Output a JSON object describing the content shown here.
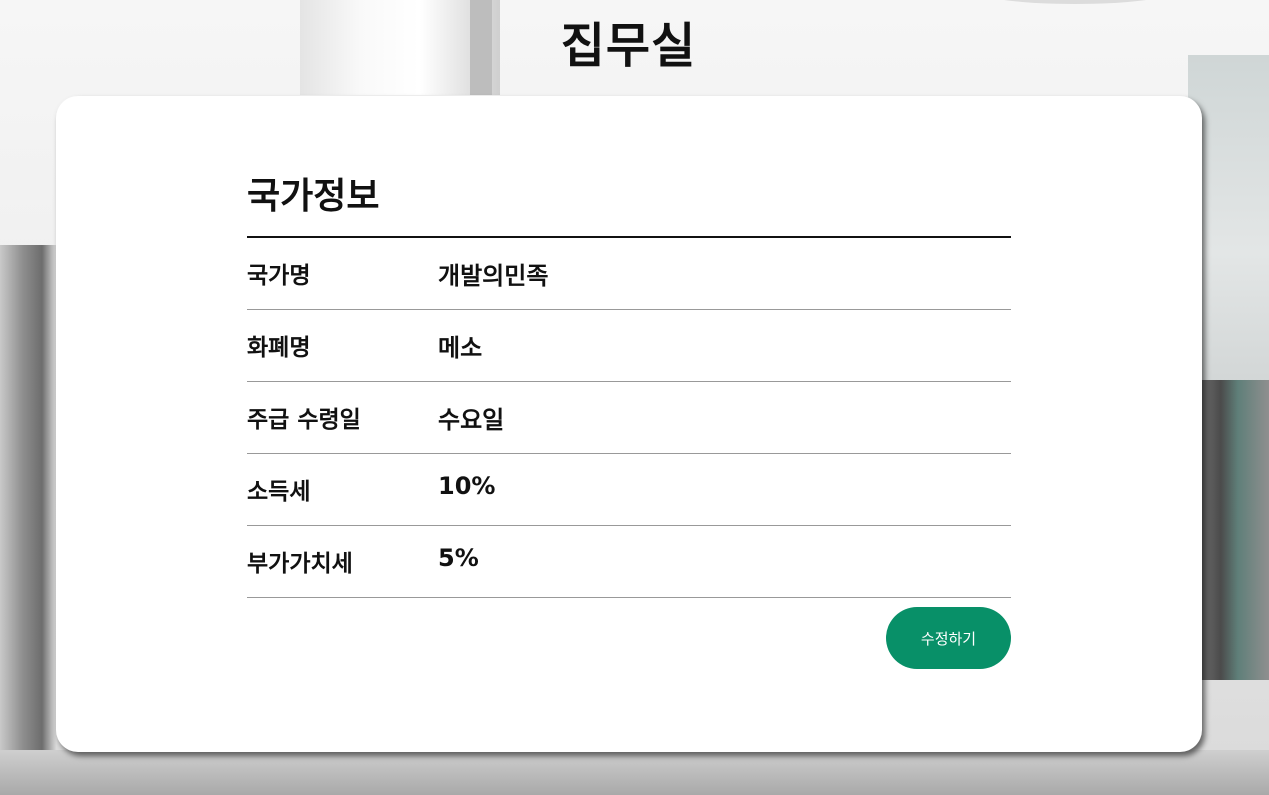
{
  "page": {
    "title": "집무실"
  },
  "country_info": {
    "heading": "국가정보",
    "rows": [
      {
        "label": "국가명",
        "value": "개발의민족"
      },
      {
        "label": "화폐명",
        "value": "메소"
      },
      {
        "label": "주급 수령일",
        "value": "수요일"
      },
      {
        "label": "소득세",
        "value": "10%"
      },
      {
        "label": "부가가치세",
        "value": "5%"
      }
    ],
    "edit_button_label": "수정하기"
  },
  "colors": {
    "accent": "#089068",
    "text": "#111111",
    "divider": "#999999"
  }
}
